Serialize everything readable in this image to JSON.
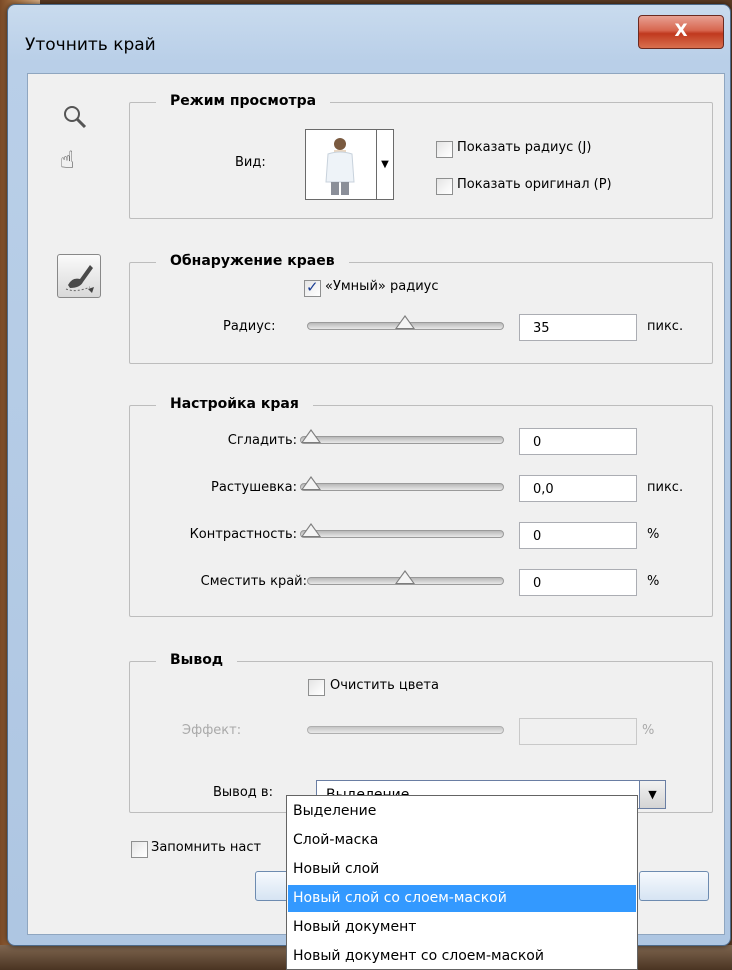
{
  "window": {
    "title": "Уточнить край",
    "close_label": "X"
  },
  "tools": [
    "zoom-icon",
    "hand-icon",
    "refine-radius-brush-icon"
  ],
  "view_mode": {
    "legend": "Режим просмотра",
    "view_label": "Вид:",
    "show_radius": {
      "label": "Показать радиус (J)",
      "checked": false
    },
    "show_original": {
      "label": "Показать оригинал (P)",
      "checked": false
    }
  },
  "edge_detection": {
    "legend": "Обнаружение краев",
    "smart_radius": {
      "label": "«Умный» радиус",
      "checked": true
    },
    "radius": {
      "label": "Радиус:",
      "value": "35",
      "unit": "пикс.",
      "slider": 0.5
    }
  },
  "adjust_edge": {
    "legend": "Настройка края",
    "smooth": {
      "label": "Сгладить:",
      "value": "0",
      "unit": "",
      "slider": 0
    },
    "feather": {
      "label": "Растушевка:",
      "value": "0,0",
      "unit": "пикс.",
      "slider": 0
    },
    "contrast": {
      "label": "Контрастность:",
      "value": "0",
      "unit": "%",
      "slider": 0
    },
    "shift_edge": {
      "label": "Сместить край:",
      "value": "0",
      "unit": "%",
      "slider": 0.5
    }
  },
  "output": {
    "legend": "Вывод",
    "decontaminate": {
      "label": "Очистить цвета",
      "checked": false
    },
    "amount": {
      "label": "Эффект:",
      "value": "",
      "unit": "%"
    },
    "output_to": {
      "label": "Вывод в:",
      "value": "Выделение"
    },
    "options": [
      "Выделение",
      "Слой-маска",
      "Новый слой",
      "Новый слой со слоем-маской",
      "Новый документ",
      "Новый документ со слоем-маской"
    ],
    "highlighted_index": 3
  },
  "remember": {
    "label": "Запомнить наст",
    "checked": false
  },
  "colors": {
    "selection": "#3399ff",
    "title_bar": "#b9cfe8",
    "close": "#c0391e"
  }
}
